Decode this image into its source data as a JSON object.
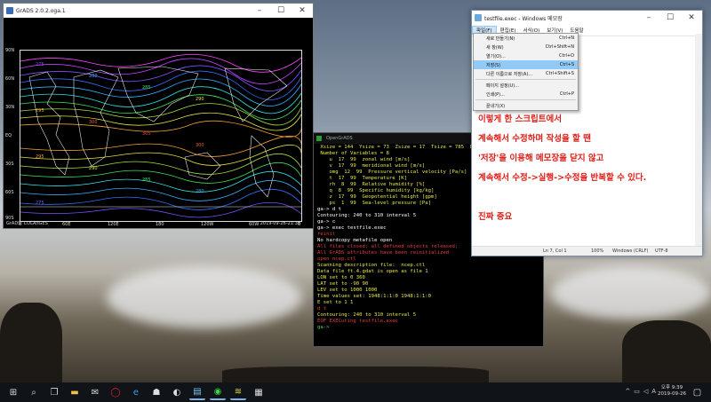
{
  "grads": {
    "title": "GrADS 2.0.2.oga.1",
    "footer_left": "GrADS: COLA/IGES",
    "footer_right": "2019-09-26-21:38",
    "lat_labels": [
      "90N",
      "60N",
      "30N",
      "EQ",
      "30S",
      "60S",
      "90S"
    ],
    "lon_labels": [
      "0",
      "60E",
      "120E",
      "180",
      "120W",
      "60W",
      "0"
    ],
    "contour_labels": [
      "275",
      "280",
      "285",
      "290",
      "295",
      "300",
      "305",
      "300",
      "295",
      "290",
      "285",
      "280",
      "275"
    ]
  },
  "notepad": {
    "title": "testfile.exec - Windows 메모장",
    "menu": [
      "파일(F)",
      "편집(E)",
      "서식(O)",
      "보기(V)",
      "도움말"
    ],
    "dropdown": [
      {
        "label": "새로 만들기(N)",
        "shortcut": "Ctrl+N"
      },
      {
        "label": "새 창(W)",
        "shortcut": "Ctrl+Shift+N"
      },
      {
        "label": "열기(O)...",
        "shortcut": "Ctrl+O"
      },
      {
        "label": "저장(S)",
        "shortcut": "Ctrl+S"
      },
      {
        "label": "다른 이름으로 저장(A)...",
        "shortcut": "Ctrl+Shift+S"
      },
      {
        "label": "페이지 설정(U)...",
        "shortcut": ""
      },
      {
        "label": "인쇄(P)...",
        "shortcut": "Ctrl+P"
      },
      {
        "label": "끝내기(X)",
        "shortcut": ""
      }
    ],
    "body_lines": [
      "이렇게 한 스크립트에서",
      "계속해서 수정하며 작성을 할 땐",
      "'저장'을 이용해 메모장을 닫지 않고",
      "계속해서 수정->실행->수정을 반복할 수 있다.",
      "",
      "진짜 중요"
    ],
    "status": {
      "position": "Ln 7, Col 1",
      "zoom": "100%",
      "eol": "Windows (CRLF)",
      "encoding": "UTF-8"
    }
  },
  "terminal": {
    "title": "OpenGrADS",
    "lines": [
      {
        "c": "y",
        "t": " Xsize = 144  Ysize = 73  Zsize = 17  Tsize = 785  E"
      },
      {
        "c": "y",
        "t": " Number of Variables = 8"
      },
      {
        "c": "y",
        "t": "    u  17  99  zonal wind [m/s]"
      },
      {
        "c": "y",
        "t": "    v  17  99  meridional wind [m/s]"
      },
      {
        "c": "y",
        "t": "    omg  12  99  Pressure vertical velocity [Pa/s]"
      },
      {
        "c": "y",
        "t": "    t  17  99  Temperature [K]"
      },
      {
        "c": "y",
        "t": "    rh  8  99  Relative humidity [%]"
      },
      {
        "c": "y",
        "t": "    q  8  99  Specific humidity [kg/kg]"
      },
      {
        "c": "y",
        "t": "    z  17  99  Geopotential height [gpm]"
      },
      {
        "c": "y",
        "t": "    ps  1  99  Sea-level pressure [Pa]"
      },
      {
        "c": "w",
        "t": "ga-> d t"
      },
      {
        "c": "w",
        "t": "Contouring: 240 to 310 interval 5"
      },
      {
        "c": "w",
        "t": "ga-> c"
      },
      {
        "c": "w",
        "t": "ga-> exec testfile.exec"
      },
      {
        "c": "r",
        "t": "reinit"
      },
      {
        "c": "w",
        "t": "No hardcopy metafile open"
      },
      {
        "c": "r",
        "t": "All files closed; all defined objects released;"
      },
      {
        "c": "r",
        "t": "All GrADS attributes have been reinitialized"
      },
      {
        "c": "r",
        "t": "open ncep.ctl"
      },
      {
        "c": "y",
        "t": "Scanning description file:  ncep.ctl"
      },
      {
        "c": "y",
        "t": "Data file ft.4.gdat is open as file 1"
      },
      {
        "c": "y",
        "t": "LON set to 0 360"
      },
      {
        "c": "y",
        "t": "LAT set to -90 90"
      },
      {
        "c": "y",
        "t": "LEV set to 1000 1000"
      },
      {
        "c": "y",
        "t": "Time values set: 1948:1:1:0 1948:1:1:0"
      },
      {
        "c": "y",
        "t": "E set to 1 1"
      },
      {
        "c": "r",
        "t": "d t"
      },
      {
        "c": "y",
        "t": "Contouring: 240 to 310 interval 5"
      },
      {
        "c": "r",
        "t": "EOF EXECuting testfile.exec"
      },
      {
        "c": "g",
        "t": "ga->"
      }
    ]
  },
  "taskbar": {
    "time": "오후 9:39",
    "date": "2019-09-26",
    "lang": "A"
  }
}
